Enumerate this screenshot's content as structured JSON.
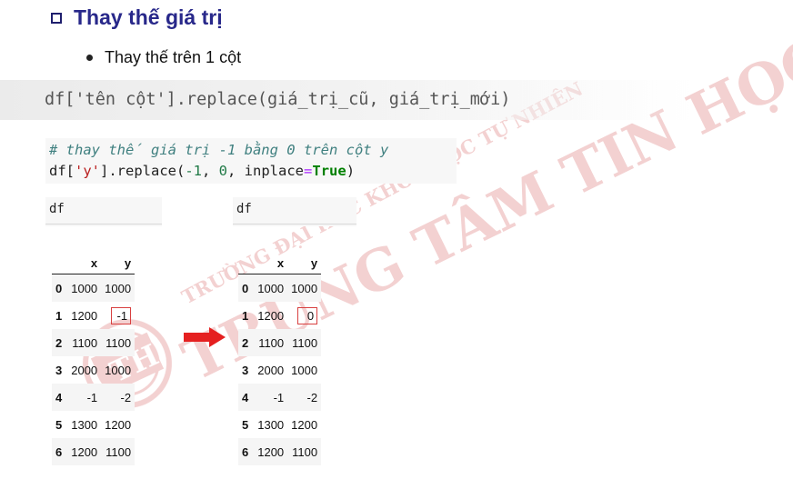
{
  "heading": "Thay thế giá trị",
  "bullet": "Thay thế trên 1 cột",
  "syntax_code": "df['tên cột'].replace(giá_trị_cũ, giá_trị_mới)",
  "notebook": {
    "comment": "# thay thế giá trị -1 bằng 0 trên cột y",
    "code": {
      "prefix": "df[",
      "col": "'y'",
      "mid1": "].replace(",
      "old": "-1",
      "sep1": ", ",
      "new": "0",
      "sep2": ", inplace",
      "eq": "=",
      "kw": "True",
      "suffix": ")"
    }
  },
  "cell_label": "df",
  "columns": [
    "",
    "x",
    "y"
  ],
  "table_before": [
    [
      "0",
      "1000",
      "1000"
    ],
    [
      "1",
      "1200",
      "-1"
    ],
    [
      "2",
      "1100",
      "1100"
    ],
    [
      "3",
      "2000",
      "1000"
    ],
    [
      "4",
      "-1",
      "-2"
    ],
    [
      "5",
      "1300",
      "1200"
    ],
    [
      "6",
      "1200",
      "1100"
    ]
  ],
  "table_after": [
    [
      "0",
      "1000",
      "1000"
    ],
    [
      "1",
      "1200",
      "0"
    ],
    [
      "2",
      "1100",
      "1100"
    ],
    [
      "3",
      "2000",
      "1000"
    ],
    [
      "4",
      "-1",
      "-2"
    ],
    [
      "5",
      "1300",
      "1200"
    ],
    [
      "6",
      "1200",
      "1100"
    ]
  ],
  "watermark": {
    "text_big": "TRUNG TÂM TIN HỌC",
    "text_arc": "TRƯỜNG ĐẠI HỌC KHOA HỌC TỰ NHIÊN",
    "logo_letters": "TH",
    "color": "#e08080"
  },
  "colors": {
    "heading": "#28288a",
    "highlight_box": "#d84040",
    "arrow": "#e52020"
  }
}
